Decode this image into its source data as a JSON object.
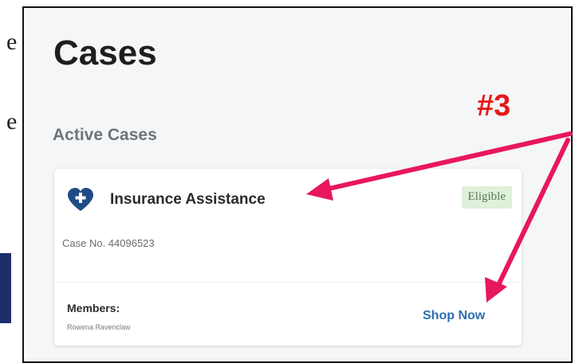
{
  "page": {
    "title": "Cases"
  },
  "section": {
    "title": "Active Cases"
  },
  "annotation": {
    "label": "#3",
    "color": "#e61919"
  },
  "card": {
    "name": "Insurance Assistance",
    "icon": "heart-plus-icon",
    "status": "Eligible",
    "case_number": "Case No. 44096523",
    "members_label": "Members:",
    "member_name": "Rowena Ravenclaw",
    "action_label": "Shop Now"
  },
  "colors": {
    "brand": "#1f4c85",
    "link": "#2f6db3",
    "badge_bg": "#dff0db",
    "page_bg": "#f5f6f8"
  }
}
